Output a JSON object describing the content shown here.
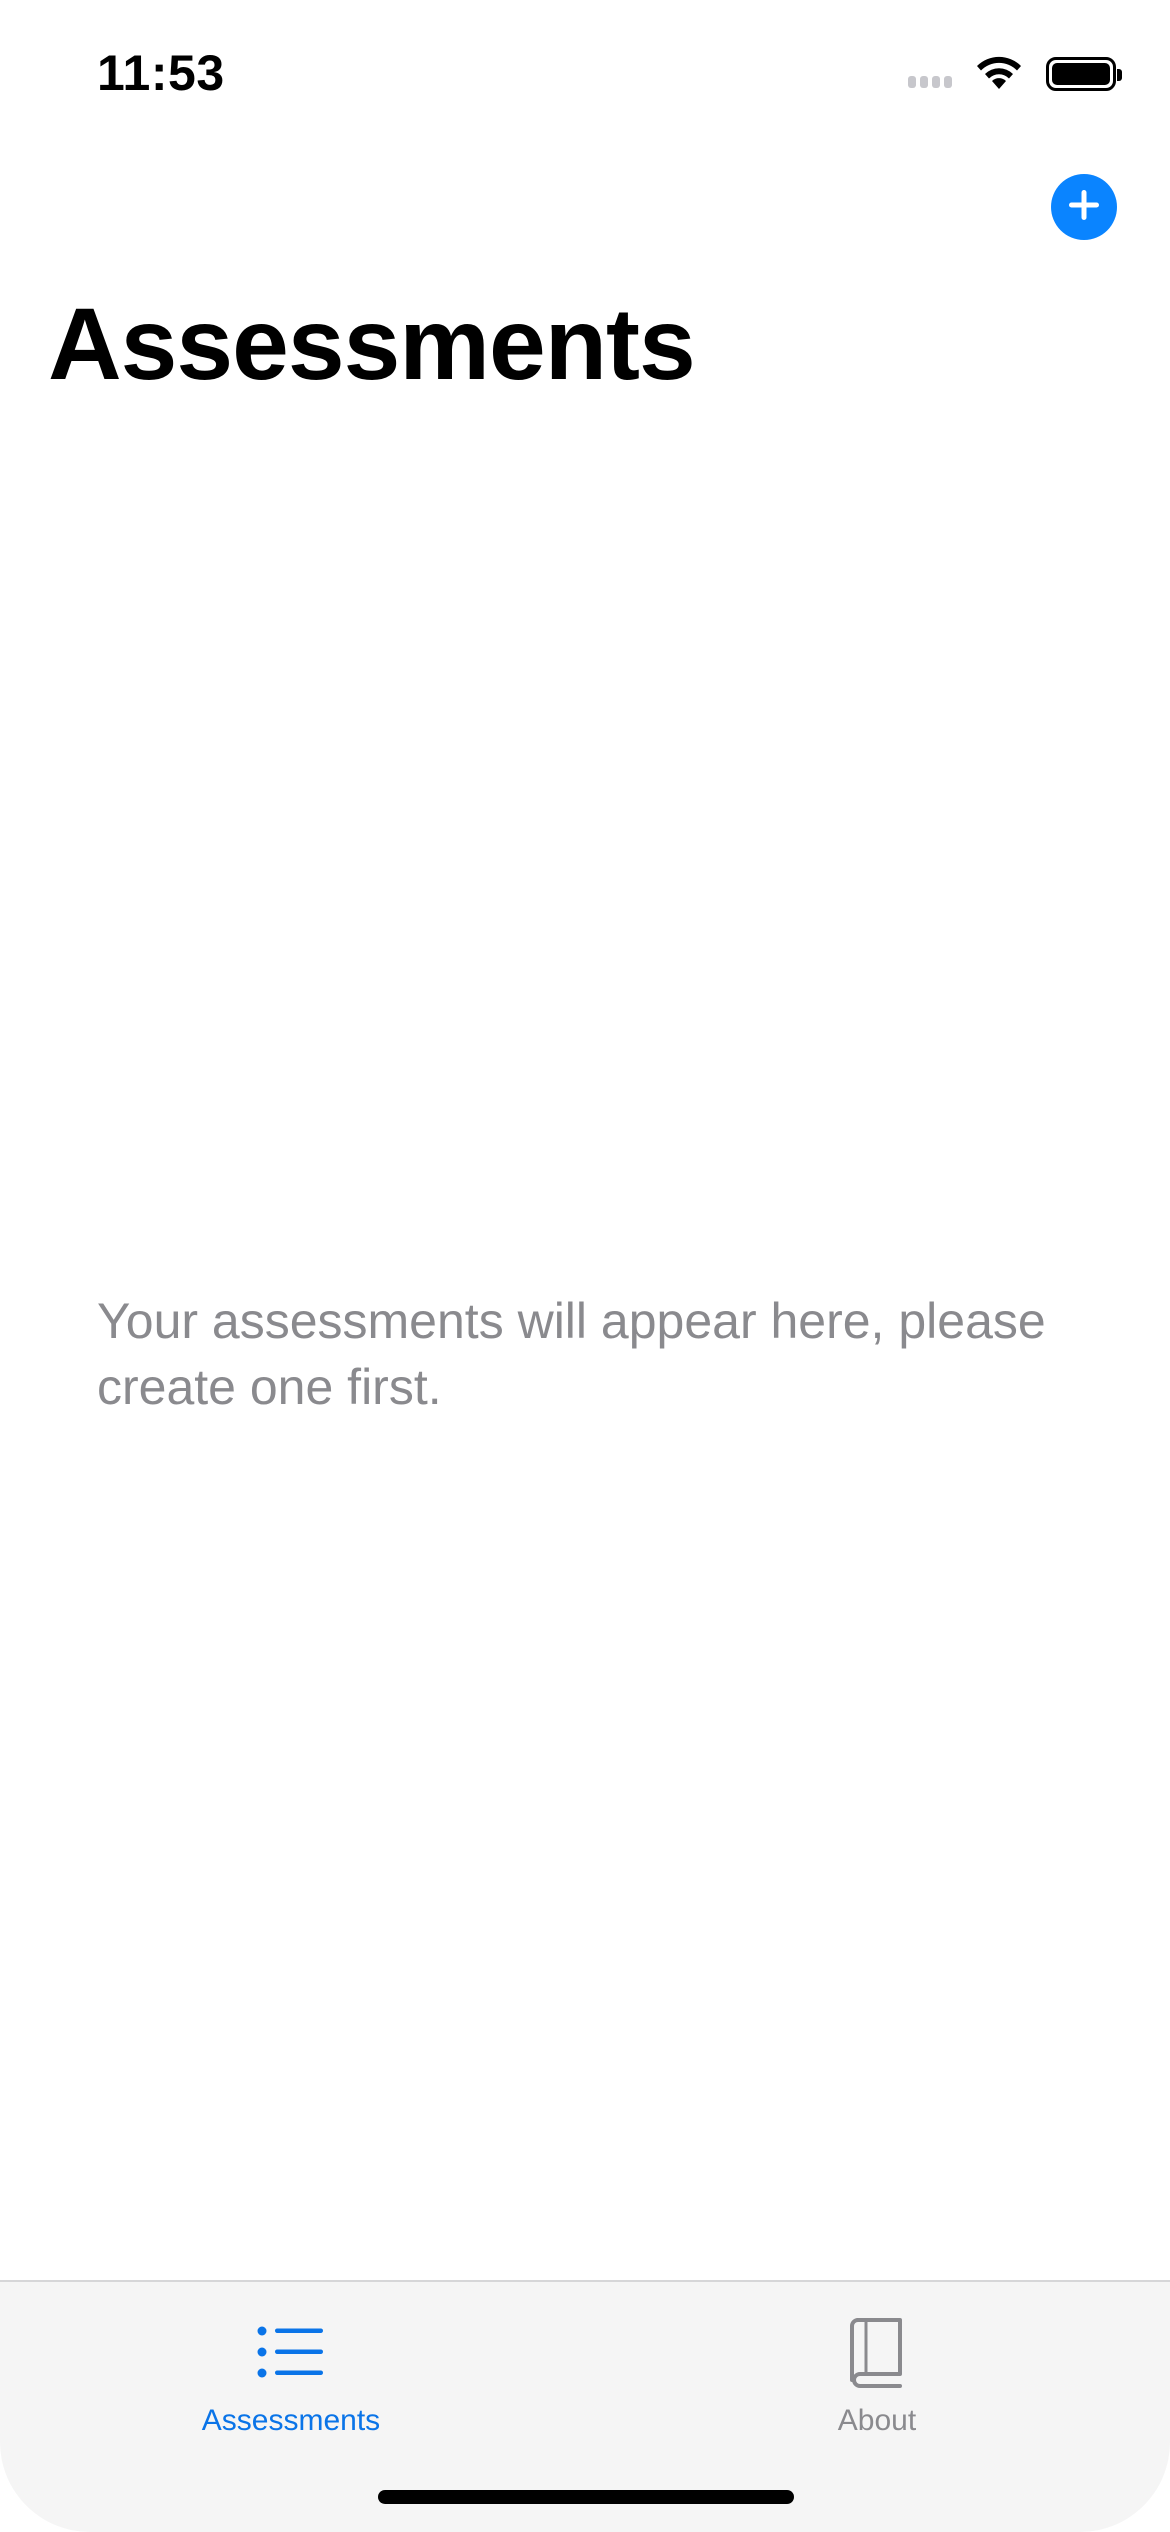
{
  "status_bar": {
    "time": "11:53",
    "wifi_icon": "wifi-icon",
    "battery_icon": "battery-icon",
    "signal_icon": "cellular-signal-icon"
  },
  "nav": {
    "add_icon": "plus-circle-icon",
    "title": "Assessments"
  },
  "main": {
    "empty_message": "Your assessments will appear here, please create one first."
  },
  "tab_bar": {
    "tabs": [
      {
        "label": "Assessments",
        "icon": "list-bullet-icon",
        "active": true
      },
      {
        "label": "About",
        "icon": "book-icon",
        "active": false
      }
    ]
  },
  "colors": {
    "accent": "#0A84FF",
    "secondary_text": "#8A8A8E",
    "tab_bar_bg": "#F5F5F5"
  }
}
